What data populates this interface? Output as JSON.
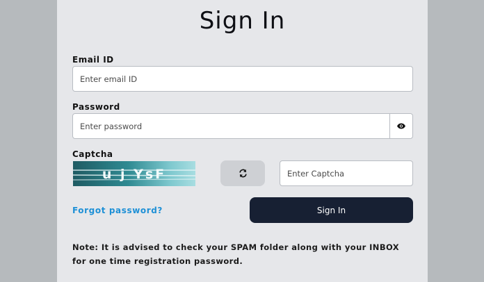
{
  "form": {
    "title": "Sign In",
    "email": {
      "label": "Email ID",
      "placeholder": "Enter email ID",
      "value": ""
    },
    "password": {
      "label": "Password",
      "placeholder": "Enter password",
      "value": "",
      "toggle_icon": "eye-icon"
    },
    "captcha": {
      "label": "Captcha",
      "image_text": "u j YsF",
      "refresh_icon": "refresh-icon",
      "placeholder": "Enter Captcha",
      "value": ""
    },
    "forgot_password": "Forgot password?",
    "submit_label": "Sign In",
    "note": "Note: It is advised to check your SPAM folder along with your INBOX for one time registration password."
  },
  "colors": {
    "background": "#b6babd",
    "card": "#e6e7ea",
    "primary_button": "#172033",
    "link": "#1e90d6",
    "secondary_button": "#ced0d4"
  }
}
